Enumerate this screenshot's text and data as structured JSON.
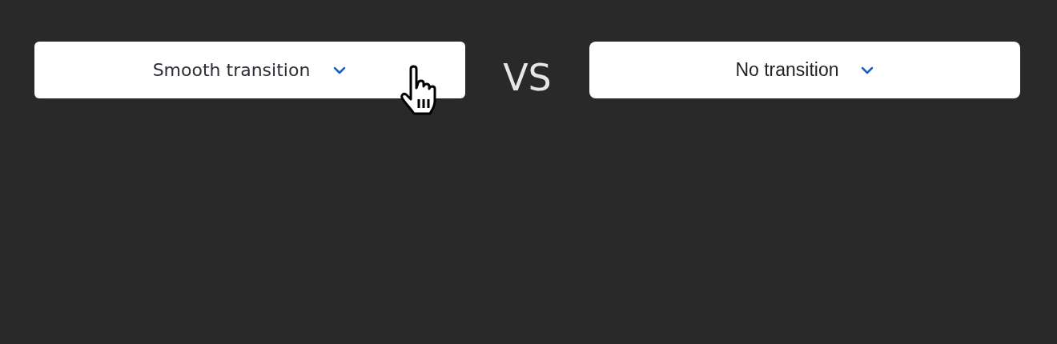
{
  "comparison": {
    "left": {
      "label": "Smooth transition"
    },
    "separator": "VS",
    "right": {
      "label": "No transition"
    }
  }
}
